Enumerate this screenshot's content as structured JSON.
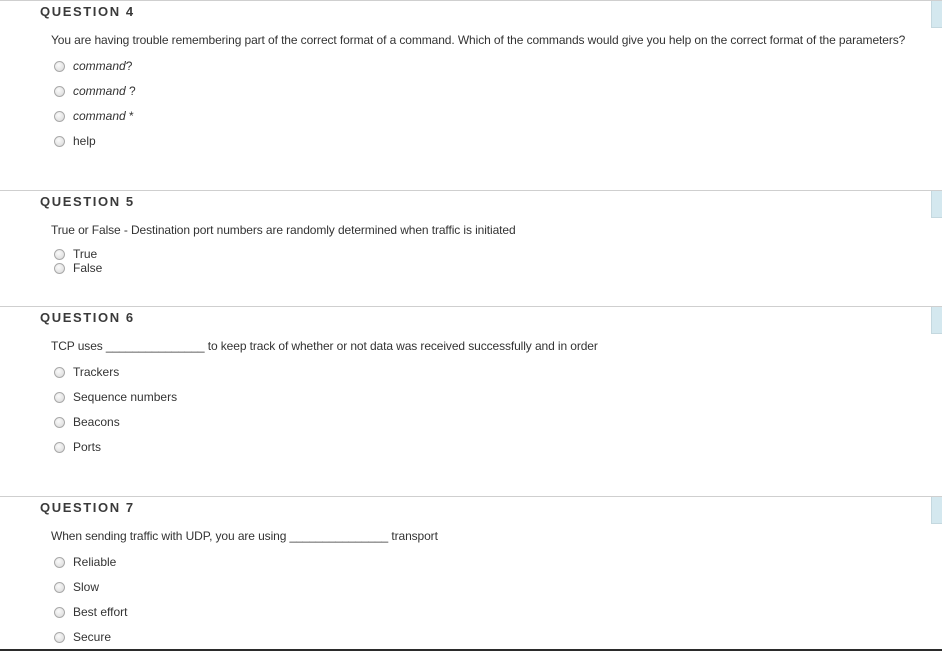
{
  "questions": [
    {
      "title": "QUESTION 4",
      "text": "You are having trouble remembering part of the correct format of a command. Which of the commands would give you help on the correct format of the parameters?",
      "options": [
        {
          "italic": "command",
          "suffix": "?"
        },
        {
          "italic": "command",
          "suffix": " ?"
        },
        {
          "italic": "command",
          "suffix": " *"
        },
        {
          "italic": "",
          "suffix": "help"
        }
      ]
    },
    {
      "title": "QUESTION 5",
      "text": "True or False - Destination port numbers are randomly determined when traffic is initiated",
      "options": [
        {
          "italic": "",
          "suffix": "True"
        },
        {
          "italic": "",
          "suffix": "False"
        }
      ]
    },
    {
      "title": "QUESTION 6",
      "text": "TCP uses _______________ to keep track of whether or not data was received successfully and in order",
      "options": [
        {
          "italic": "",
          "suffix": "Trackers"
        },
        {
          "italic": "",
          "suffix": "Sequence numbers"
        },
        {
          "italic": "",
          "suffix": "Beacons"
        },
        {
          "italic": "",
          "suffix": "Ports"
        }
      ]
    },
    {
      "title": "QUESTION 7",
      "text": "When sending traffic with UDP, you are using _______________ transport",
      "options": [
        {
          "italic": "",
          "suffix": "Reliable"
        },
        {
          "italic": "",
          "suffix": "Slow"
        },
        {
          "italic": "",
          "suffix": "Best effort"
        },
        {
          "italic": "",
          "suffix": "Secure"
        }
      ]
    }
  ]
}
